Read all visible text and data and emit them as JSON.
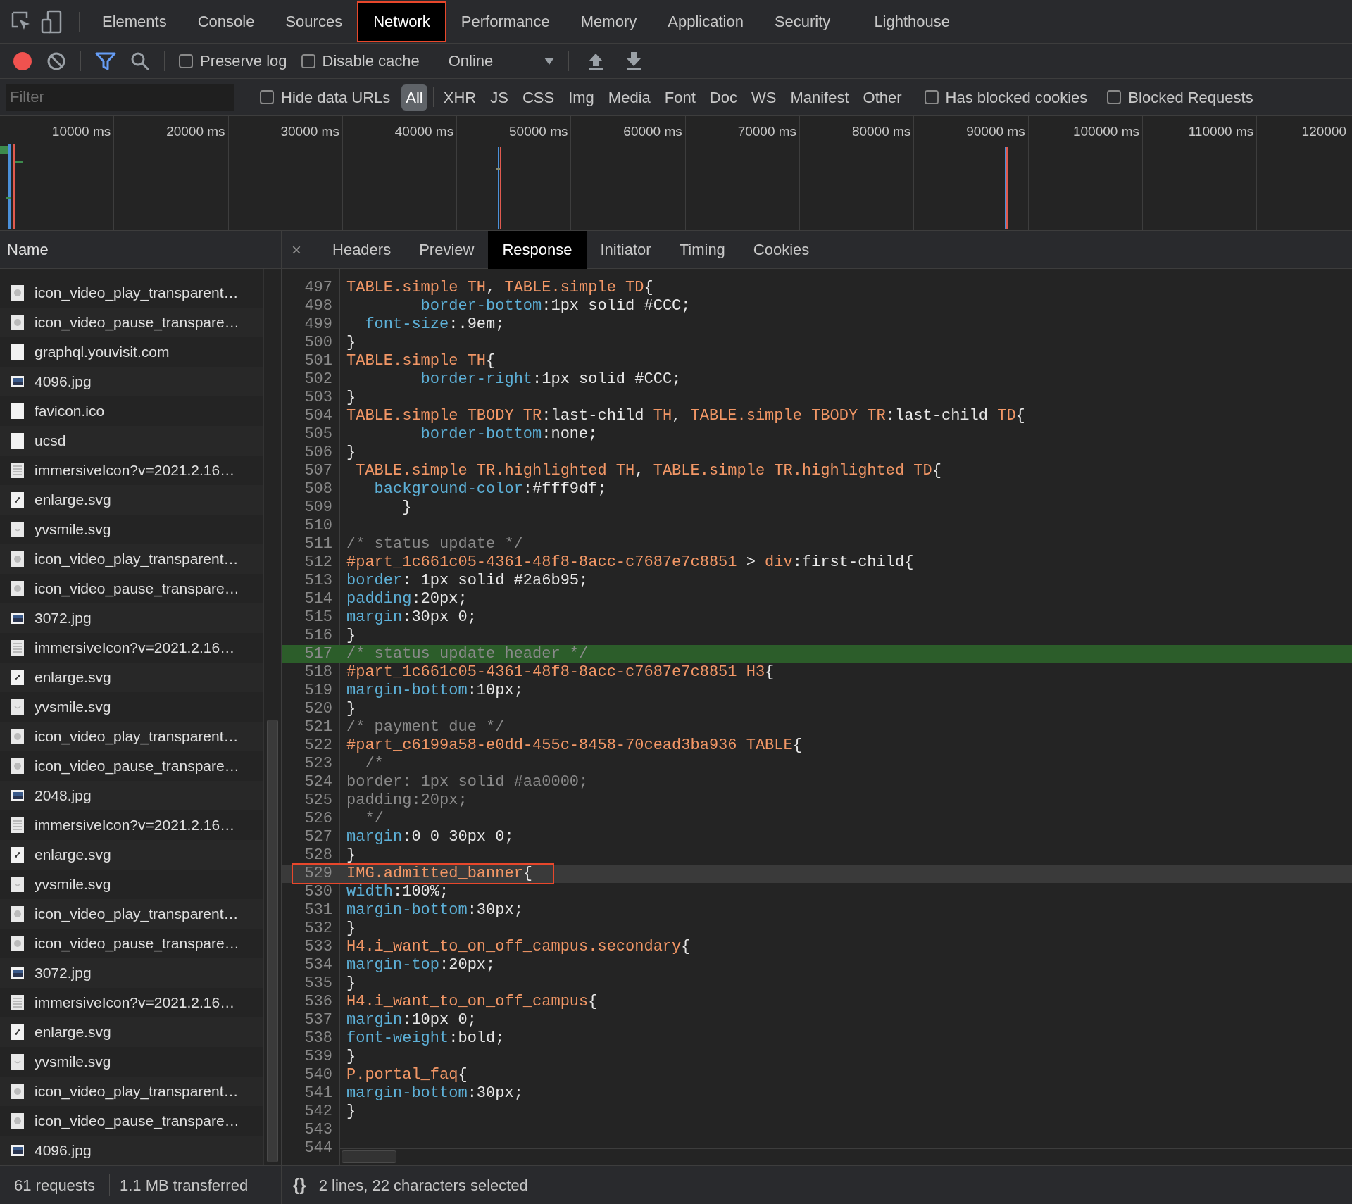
{
  "main_tabs": [
    {
      "label": "Elements",
      "selected": false,
      "outlined": false
    },
    {
      "label": "Console",
      "selected": false,
      "outlined": false
    },
    {
      "label": "Sources",
      "selected": false,
      "outlined": false
    },
    {
      "label": "Network",
      "selected": true,
      "outlined": true
    },
    {
      "label": "Performance",
      "selected": false,
      "outlined": false
    },
    {
      "label": "Memory",
      "selected": false,
      "outlined": false
    },
    {
      "label": "Application",
      "selected": false,
      "outlined": false
    },
    {
      "label": "Security",
      "selected": false,
      "outlined": false
    },
    {
      "label": "Lighthouse",
      "selected": false,
      "outlined": false
    }
  ],
  "toolbar": {
    "preserve_log": {
      "label": "Preserve log",
      "checked": false
    },
    "disable_cache": {
      "label": "Disable cache",
      "checked": false
    },
    "throttling": "Online"
  },
  "filter_bar": {
    "placeholder": "Filter",
    "hide_data_urls": {
      "label": "Hide data URLs",
      "checked": false
    },
    "types": [
      {
        "label": "All",
        "selected": true
      },
      {
        "label": "XHR",
        "selected": false
      },
      {
        "label": "JS",
        "selected": false
      },
      {
        "label": "CSS",
        "selected": false
      },
      {
        "label": "Img",
        "selected": false
      },
      {
        "label": "Media",
        "selected": false
      },
      {
        "label": "Font",
        "selected": false
      },
      {
        "label": "Doc",
        "selected": false
      },
      {
        "label": "WS",
        "selected": false
      },
      {
        "label": "Manifest",
        "selected": false
      },
      {
        "label": "Other",
        "selected": false
      }
    ],
    "has_blocked_cookies": {
      "label": "Has blocked cookies",
      "checked": false
    },
    "blocked_requests": {
      "label": "Blocked Requests",
      "checked": false
    }
  },
  "timeline": {
    "ticks": [
      "10000 ms",
      "20000 ms",
      "30000 ms",
      "40000 ms",
      "50000 ms",
      "60000 ms",
      "70000 ms",
      "80000 ms",
      "90000 ms",
      "100000 ms",
      "110000 ms",
      "120000"
    ]
  },
  "requests": {
    "column": "Name",
    "items": [
      {
        "name": "icon_video_play_transparent…",
        "kind": "media"
      },
      {
        "name": "icon_video_pause_transpare…",
        "kind": "media"
      },
      {
        "name": "graphql.youvisit.com",
        "kind": "document"
      },
      {
        "name": "4096.jpg",
        "kind": "photo"
      },
      {
        "name": "favicon.ico",
        "kind": "document"
      },
      {
        "name": "ucsd",
        "kind": "document"
      },
      {
        "name": "immersiveIcon?v=2021.2.16…",
        "kind": "lines"
      },
      {
        "name": "enlarge.svg",
        "kind": "enlarge"
      },
      {
        "name": "yvsmile.svg",
        "kind": "smile"
      },
      {
        "name": "icon_video_play_transparent…",
        "kind": "media"
      },
      {
        "name": "icon_video_pause_transpare…",
        "kind": "media"
      },
      {
        "name": "3072.jpg",
        "kind": "photo"
      },
      {
        "name": "immersiveIcon?v=2021.2.16…",
        "kind": "lines"
      },
      {
        "name": "enlarge.svg",
        "kind": "enlarge"
      },
      {
        "name": "yvsmile.svg",
        "kind": "smile"
      },
      {
        "name": "icon_video_play_transparent…",
        "kind": "media"
      },
      {
        "name": "icon_video_pause_transpare…",
        "kind": "media"
      },
      {
        "name": "2048.jpg",
        "kind": "photo"
      },
      {
        "name": "immersiveIcon?v=2021.2.16…",
        "kind": "lines"
      },
      {
        "name": "enlarge.svg",
        "kind": "enlarge"
      },
      {
        "name": "yvsmile.svg",
        "kind": "smile"
      },
      {
        "name": "icon_video_play_transparent…",
        "kind": "media"
      },
      {
        "name": "icon_video_pause_transpare…",
        "kind": "media"
      },
      {
        "name": "3072.jpg",
        "kind": "photo"
      },
      {
        "name": "immersiveIcon?v=2021.2.16…",
        "kind": "lines"
      },
      {
        "name": "enlarge.svg",
        "kind": "enlarge"
      },
      {
        "name": "yvsmile.svg",
        "kind": "smile"
      },
      {
        "name": "icon_video_play_transparent…",
        "kind": "media"
      },
      {
        "name": "icon_video_pause_transpare…",
        "kind": "media"
      },
      {
        "name": "4096.jpg",
        "kind": "photo"
      }
    ],
    "status": {
      "requests": "61 requests",
      "transferred": "1.1 MB transferred"
    }
  },
  "detail_tabs": {
    "close": "×",
    "tabs": [
      {
        "label": "Headers",
        "selected": false
      },
      {
        "label": "Preview",
        "selected": false
      },
      {
        "label": "Response",
        "selected": true
      },
      {
        "label": "Initiator",
        "selected": false
      },
      {
        "label": "Timing",
        "selected": false
      },
      {
        "label": "Cookies",
        "selected": false
      }
    ]
  },
  "response": {
    "lines": [
      {
        "number": "497",
        "matched": false,
        "current": false,
        "outlined": false,
        "segments": [
          {
            "kind": "selector",
            "text": "TABLE.simple TH"
          },
          {
            "kind": "plain",
            "text": ", "
          },
          {
            "kind": "selector",
            "text": "TABLE.simple TD"
          },
          {
            "kind": "plain",
            "text": "{"
          }
        ]
      },
      {
        "number": "498",
        "matched": false,
        "current": false,
        "outlined": false,
        "segments": [
          {
            "kind": "property",
            "text": "        border-bottom"
          },
          {
            "kind": "plain",
            "text": ":1px solid #CCC;"
          }
        ]
      },
      {
        "number": "499",
        "matched": false,
        "current": false,
        "outlined": false,
        "segments": [
          {
            "kind": "property",
            "text": "  font-size"
          },
          {
            "kind": "plain",
            "text": ":.9em;"
          }
        ]
      },
      {
        "number": "500",
        "matched": false,
        "current": false,
        "outlined": false,
        "segments": [
          {
            "kind": "plain",
            "text": "}"
          }
        ]
      },
      {
        "number": "501",
        "matched": false,
        "current": false,
        "outlined": false,
        "segments": [
          {
            "kind": "selector",
            "text": "TABLE.simple TH"
          },
          {
            "kind": "plain",
            "text": "{"
          }
        ]
      },
      {
        "number": "502",
        "matched": false,
        "current": false,
        "outlined": false,
        "segments": [
          {
            "kind": "property",
            "text": "        border-right"
          },
          {
            "kind": "plain",
            "text": ":1px solid #CCC;"
          }
        ]
      },
      {
        "number": "503",
        "matched": false,
        "current": false,
        "outlined": false,
        "segments": [
          {
            "kind": "plain",
            "text": "}"
          }
        ]
      },
      {
        "number": "504",
        "matched": false,
        "current": false,
        "outlined": false,
        "segments": [
          {
            "kind": "selector",
            "text": "TABLE.simple TBODY TR"
          },
          {
            "kind": "plain",
            "text": ":last-child "
          },
          {
            "kind": "selector",
            "text": "TH"
          },
          {
            "kind": "plain",
            "text": ", "
          },
          {
            "kind": "selector",
            "text": "TABLE.simple TBODY TR"
          },
          {
            "kind": "plain",
            "text": ":last-child "
          },
          {
            "kind": "selector",
            "text": "TD"
          },
          {
            "kind": "plain",
            "text": "{"
          }
        ]
      },
      {
        "number": "505",
        "matched": false,
        "current": false,
        "outlined": false,
        "segments": [
          {
            "kind": "property",
            "text": "        border-bottom"
          },
          {
            "kind": "plain",
            "text": ":none;"
          }
        ]
      },
      {
        "number": "506",
        "matched": false,
        "current": false,
        "outlined": false,
        "segments": [
          {
            "kind": "plain",
            "text": "}"
          }
        ]
      },
      {
        "number": "507",
        "matched": false,
        "current": false,
        "outlined": false,
        "segments": [
          {
            "kind": "selector",
            "text": " TABLE.simple TR.highlighted TH"
          },
          {
            "kind": "plain",
            "text": ", "
          },
          {
            "kind": "selector",
            "text": "TABLE.simple TR.highlighted TD"
          },
          {
            "kind": "plain",
            "text": "{"
          }
        ]
      },
      {
        "number": "508",
        "matched": false,
        "current": false,
        "outlined": false,
        "segments": [
          {
            "kind": "property",
            "text": "   background-color"
          },
          {
            "kind": "plain",
            "text": ":#fff9df;"
          }
        ]
      },
      {
        "number": "509",
        "matched": false,
        "current": false,
        "outlined": false,
        "segments": [
          {
            "kind": "plain",
            "text": "      }"
          }
        ]
      },
      {
        "number": "510",
        "matched": false,
        "current": false,
        "outlined": false
      },
      {
        "number": "511",
        "matched": false,
        "current": false,
        "outlined": false,
        "segments": [
          {
            "kind": "comment",
            "text": "/* status update */"
          }
        ]
      },
      {
        "number": "512",
        "matched": false,
        "current": false,
        "outlined": false,
        "segments": [
          {
            "kind": "selector",
            "text": "#part_1c661c05-4361-48f8-8acc-c7687e7c8851"
          },
          {
            "kind": "plain",
            "text": " > "
          },
          {
            "kind": "selector",
            "text": "div"
          },
          {
            "kind": "plain",
            "text": ":first-child{"
          }
        ]
      },
      {
        "number": "513",
        "matched": false,
        "current": false,
        "outlined": false,
        "segments": [
          {
            "kind": "property",
            "text": "border"
          },
          {
            "kind": "plain",
            "text": ": 1px solid #2a6b95;"
          }
        ]
      },
      {
        "number": "514",
        "matched": false,
        "current": false,
        "outlined": false,
        "segments": [
          {
            "kind": "property",
            "text": "padding"
          },
          {
            "kind": "plain",
            "text": ":20px;"
          }
        ]
      },
      {
        "number": "515",
        "matched": false,
        "current": false,
        "outlined": false,
        "segments": [
          {
            "kind": "property",
            "text": "margin"
          },
          {
            "kind": "plain",
            "text": ":30px 0;"
          }
        ]
      },
      {
        "number": "516",
        "matched": false,
        "current": false,
        "outlined": false,
        "segments": [
          {
            "kind": "plain",
            "text": "}"
          }
        ]
      },
      {
        "number": "517",
        "matched": true,
        "current": false,
        "outlined": false,
        "segments": [
          {
            "kind": "comment",
            "text": "/* status update header */"
          }
        ]
      },
      {
        "number": "518",
        "matched": false,
        "current": false,
        "outlined": false,
        "segments": [
          {
            "kind": "selector",
            "text": "#part_1c661c05-4361-48f8-8acc-c7687e7c8851 H3"
          },
          {
            "kind": "plain",
            "text": "{"
          }
        ]
      },
      {
        "number": "519",
        "matched": false,
        "current": false,
        "outlined": false,
        "segments": [
          {
            "kind": "property",
            "text": "margin-bottom"
          },
          {
            "kind": "plain",
            "text": ":10px;"
          }
        ]
      },
      {
        "number": "520",
        "matched": false,
        "current": false,
        "outlined": false,
        "segments": [
          {
            "kind": "plain",
            "text": "}"
          }
        ]
      },
      {
        "number": "521",
        "matched": false,
        "current": false,
        "outlined": false,
        "segments": [
          {
            "kind": "comment",
            "text": "/* payment due */"
          }
        ]
      },
      {
        "number": "522",
        "matched": false,
        "current": false,
        "outlined": false,
        "segments": [
          {
            "kind": "selector",
            "text": "#part_c6199a58-e0dd-455c-8458-70cead3ba936 TABLE"
          },
          {
            "kind": "plain",
            "text": "{"
          }
        ]
      },
      {
        "number": "523",
        "matched": false,
        "current": false,
        "outlined": false,
        "segments": [
          {
            "kind": "comment",
            "text": "  /*"
          }
        ]
      },
      {
        "number": "524",
        "matched": false,
        "current": false,
        "outlined": false,
        "segments": [
          {
            "kind": "comment",
            "text": "border: 1px solid #aa0000;"
          }
        ]
      },
      {
        "number": "525",
        "matched": false,
        "current": false,
        "outlined": false,
        "segments": [
          {
            "kind": "comment",
            "text": "padding:20px;"
          }
        ]
      },
      {
        "number": "526",
        "matched": false,
        "current": false,
        "outlined": false,
        "segments": [
          {
            "kind": "comment",
            "text": "  */"
          }
        ]
      },
      {
        "number": "527",
        "matched": false,
        "current": false,
        "outlined": false,
        "segments": [
          {
            "kind": "property",
            "text": "margin"
          },
          {
            "kind": "plain",
            "text": ":0 0 30px 0;"
          }
        ]
      },
      {
        "number": "528",
        "matched": false,
        "current": false,
        "outlined": false,
        "segments": [
          {
            "kind": "plain",
            "text": "}"
          }
        ]
      },
      {
        "number": "529",
        "matched": false,
        "current": true,
        "outlined": true,
        "segments": [
          {
            "kind": "selector",
            "text": "IMG.admitted_banner"
          },
          {
            "kind": "plain",
            "text": "{"
          }
        ]
      },
      {
        "number": "530",
        "matched": false,
        "current": false,
        "outlined": false,
        "segments": [
          {
            "kind": "property",
            "text": "width"
          },
          {
            "kind": "plain",
            "text": ":100%;"
          }
        ]
      },
      {
        "number": "531",
        "matched": false,
        "current": false,
        "outlined": false,
        "segments": [
          {
            "kind": "property",
            "text": "margin-bottom"
          },
          {
            "kind": "plain",
            "text": ":30px;"
          }
        ]
      },
      {
        "number": "532",
        "matched": false,
        "current": false,
        "outlined": false,
        "segments": [
          {
            "kind": "plain",
            "text": "}"
          }
        ]
      },
      {
        "number": "533",
        "matched": false,
        "current": false,
        "outlined": false,
        "segments": [
          {
            "kind": "selector",
            "text": "H4.i_want_to_on_off_campus.secondary"
          },
          {
            "kind": "plain",
            "text": "{"
          }
        ]
      },
      {
        "number": "534",
        "matched": false,
        "current": false,
        "outlined": false,
        "segments": [
          {
            "kind": "property",
            "text": "margin-top"
          },
          {
            "kind": "plain",
            "text": ":20px;"
          }
        ]
      },
      {
        "number": "535",
        "matched": false,
        "current": false,
        "outlined": false,
        "segments": [
          {
            "kind": "plain",
            "text": "}"
          }
        ]
      },
      {
        "number": "536",
        "matched": false,
        "current": false,
        "outlined": false,
        "segments": [
          {
            "kind": "selector",
            "text": "H4.i_want_to_on_off_campus"
          },
          {
            "kind": "plain",
            "text": "{"
          }
        ]
      },
      {
        "number": "537",
        "matched": false,
        "current": false,
        "outlined": false,
        "segments": [
          {
            "kind": "property",
            "text": "margin"
          },
          {
            "kind": "plain",
            "text": ":10px 0;"
          }
        ]
      },
      {
        "number": "538",
        "matched": false,
        "current": false,
        "outlined": false,
        "segments": [
          {
            "kind": "property",
            "text": "font-weight"
          },
          {
            "kind": "plain",
            "text": ":bold;"
          }
        ]
      },
      {
        "number": "539",
        "matched": false,
        "current": false,
        "outlined": false,
        "segments": [
          {
            "kind": "plain",
            "text": "}"
          }
        ]
      },
      {
        "number": "540",
        "matched": false,
        "current": false,
        "outlined": false,
        "segments": [
          {
            "kind": "selector",
            "text": "P.portal_faq"
          },
          {
            "kind": "plain",
            "text": "{"
          }
        ]
      },
      {
        "number": "541",
        "matched": false,
        "current": false,
        "outlined": false,
        "segments": [
          {
            "kind": "property",
            "text": "margin-bottom"
          },
          {
            "kind": "plain",
            "text": ":30px;"
          }
        ]
      },
      {
        "number": "542",
        "matched": false,
        "current": false,
        "outlined": false,
        "segments": [
          {
            "kind": "plain",
            "text": "}"
          }
        ]
      },
      {
        "number": "543",
        "matched": false,
        "current": false,
        "outlined": false
      },
      {
        "number": "544",
        "matched": false,
        "current": false,
        "outlined": false
      }
    ],
    "status": {
      "format_button": "{}",
      "selection": "2 lines, 22 characters selected"
    }
  }
}
